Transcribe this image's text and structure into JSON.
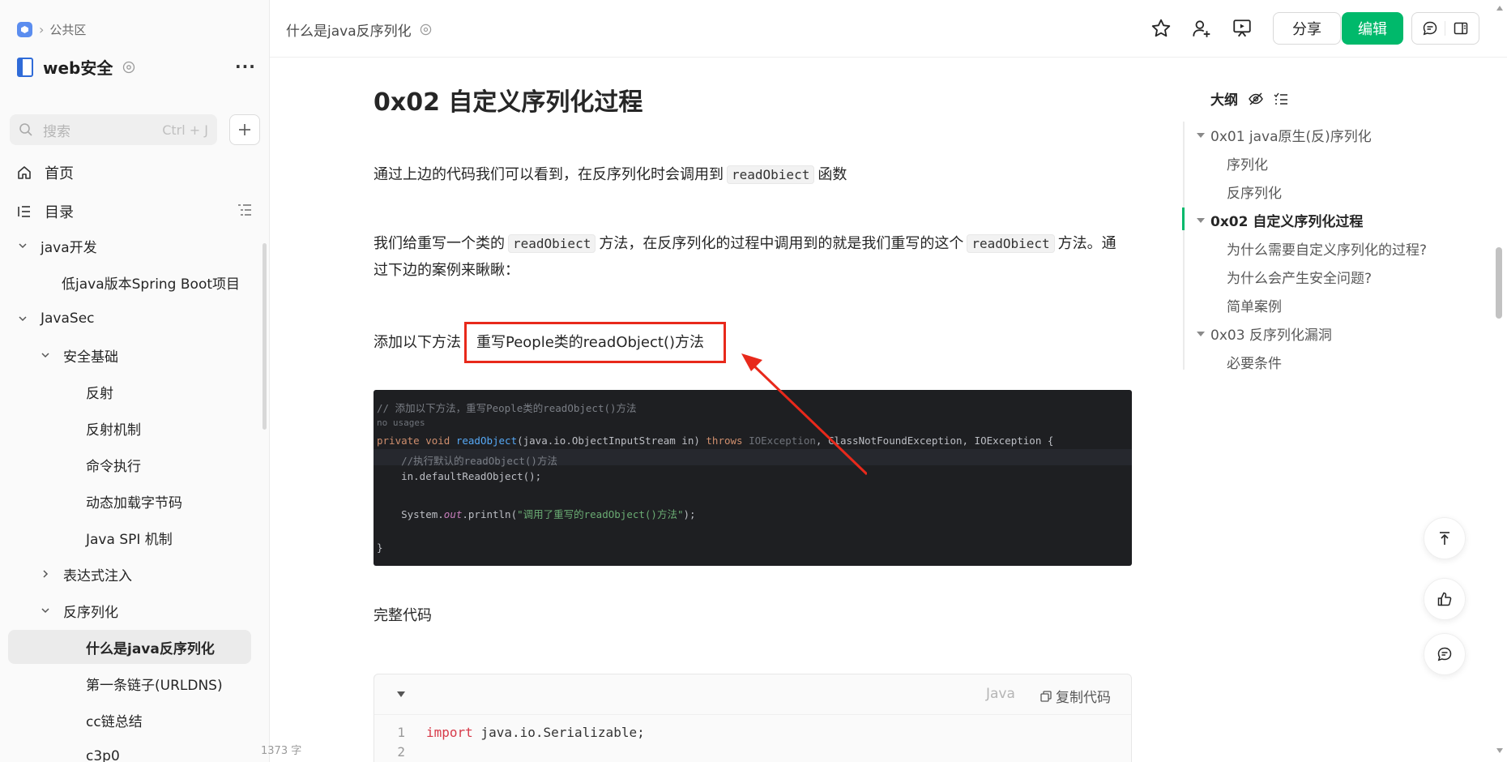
{
  "sidebar": {
    "breadcrumb": "公共区",
    "book_title": "web安全",
    "more": "···",
    "search_placeholder": "搜索",
    "search_shortcut": "Ctrl + J",
    "nav": [
      {
        "label": "首页",
        "icon": "home-icon"
      },
      {
        "label": "目录",
        "icon": "list-icon"
      }
    ],
    "tree": [
      {
        "label": "java开发",
        "expanded": true
      },
      {
        "label": "低java版本Spring Boot项目"
      },
      {
        "label": "JavaSec",
        "expanded": true
      },
      {
        "label": "安全基础",
        "expanded": true
      },
      {
        "label": "反射"
      },
      {
        "label": "反射机制"
      },
      {
        "label": "命令执行"
      },
      {
        "label": "动态加载字节码"
      },
      {
        "label": "Java SPI 机制"
      },
      {
        "label": "表达式注入",
        "expanded": false
      },
      {
        "label": "反序列化",
        "expanded": true
      },
      {
        "label": "什么是java反序列化",
        "active": true
      },
      {
        "label": "第一条链子(URLDNS)"
      },
      {
        "label": "cc链总结"
      },
      {
        "label": "c3p0"
      }
    ],
    "word_count": "1373 字"
  },
  "header": {
    "doc_title": "什么是java反序列化",
    "share_label": "分享",
    "edit_label": "编辑",
    "icons": [
      "star-icon",
      "add-collaborator-icon",
      "present-icon",
      "comment-icon",
      "layout-icon"
    ]
  },
  "content": {
    "heading": "0x02 自定义序列化过程",
    "p1_pre": "通过上边的代码我们可以看到，在反序列化时会调用到",
    "p1_code": "readObiect",
    "p1_post": "函数",
    "p2_a": "我们给重写一个类的",
    "p2_code1": "readObiect",
    "p2_b": "方法，在反序列化的过程中调用到的就是我们重写的这个",
    "p2_code2": "readObiect",
    "p2_c": "方法。通过下边的案例来瞅瞅：",
    "p3_pre": "添加以下方法",
    "p3_boxed": "重写People类的readObject()方法",
    "code_image": {
      "line1": "// 添加以下方法，重写People类的readObject()方法",
      "line2": "no usages",
      "line3_kw1": "private void ",
      "line3_fn": "readObject",
      "line3_a": "(java.io.ObjectInputStream in) ",
      "line3_kw2": "throws ",
      "line3_dim": "IOException",
      "line3_b": ", ClassNotFoundException, IOException {",
      "line4": "    //执行默认的readObject()方法",
      "line5": "    in.defaultReadObject();",
      "line7_a": "    System.",
      "line7_fld": "out",
      "line7_b": ".println(",
      "line7_str": "\"调用了重写的readObject()方法\"",
      "line7_c": ");",
      "line9": "}"
    },
    "p4": "完整代码",
    "codeblock": {
      "lang": "Java",
      "copy_label": "复制代码",
      "lines": [
        {
          "no": "1",
          "kw": "import",
          "rest": " java.io.Serializable;"
        },
        {
          "no": "2",
          "kw": "",
          "rest": ""
        }
      ]
    }
  },
  "outline": {
    "title": "大纲",
    "items": [
      {
        "label": "0x01 java原生(反)序列化",
        "level": 1
      },
      {
        "label": "序列化",
        "level": 2
      },
      {
        "label": "反序列化",
        "level": 2
      },
      {
        "label": "0x02 自定义序列化过程",
        "level": 1,
        "active": true
      },
      {
        "label": "为什么需要自定义序列化的过程?",
        "level": 2
      },
      {
        "label": "为什么会产生安全问题?",
        "level": 2
      },
      {
        "label": "简单案例",
        "level": 2
      },
      {
        "label": "0x03 反序列化漏洞",
        "level": 1
      },
      {
        "label": "必要条件",
        "level": 2
      }
    ]
  },
  "colors": {
    "accent": "#00b96b",
    "annotation_red": "#e8291b"
  }
}
